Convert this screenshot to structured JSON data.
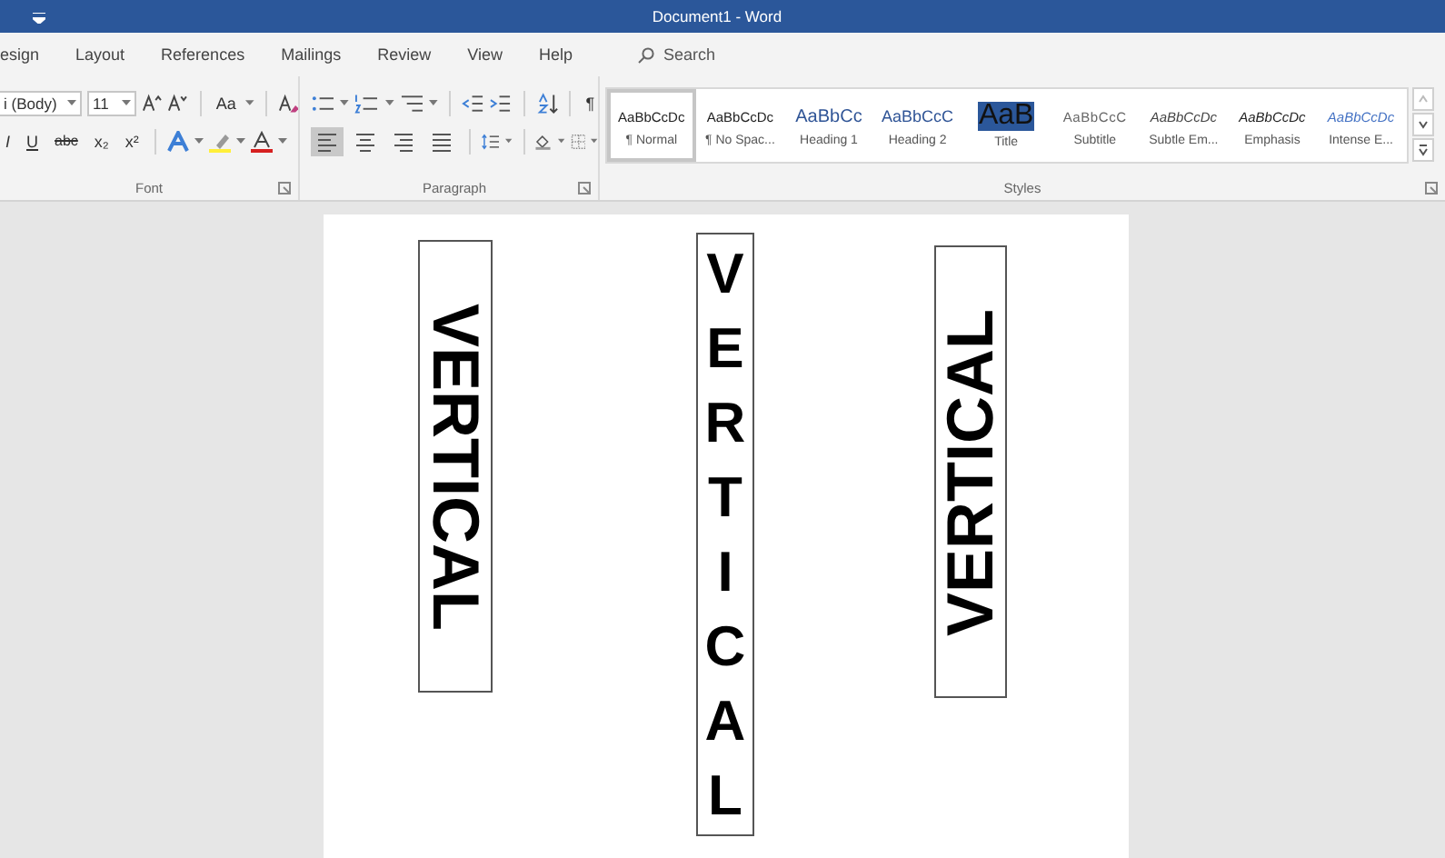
{
  "window": {
    "title": "Document1 - Word"
  },
  "tabs": [
    {
      "label": "esign",
      "selected": false
    },
    {
      "label": "Layout",
      "selected": false
    },
    {
      "label": "References",
      "selected": false
    },
    {
      "label": "Mailings",
      "selected": false
    },
    {
      "label": "Review",
      "selected": false
    },
    {
      "label": "View",
      "selected": false
    },
    {
      "label": "Help",
      "selected": false
    }
  ],
  "search": {
    "placeholder": "Search"
  },
  "font_group": {
    "label": "Font",
    "font_name": "i (Body)",
    "font_size": "11",
    "case_button": "Aa",
    "format_buttons": [
      "I",
      "U",
      "abc",
      "x₂",
      "x²"
    ]
  },
  "paragraph_group": {
    "label": "Paragraph",
    "pilcrow": "¶",
    "alignment": [
      {
        "kind": "left",
        "selected": true
      },
      {
        "kind": "center",
        "selected": false
      },
      {
        "kind": "right",
        "selected": false
      },
      {
        "kind": "justify",
        "selected": false
      }
    ]
  },
  "styles_group": {
    "label": "Styles",
    "items": [
      {
        "kind": "normal",
        "preview": "AaBbCcDc",
        "name": "¶ Normal",
        "selected": true
      },
      {
        "kind": "no-spacing",
        "preview": "AaBbCcDc",
        "name": "¶ No Spac...",
        "selected": false
      },
      {
        "kind": "heading1",
        "preview": "AaBbCc",
        "name": "Heading 1",
        "selected": false
      },
      {
        "kind": "heading2",
        "preview": "AaBbCcC",
        "name": "Heading 2",
        "selected": false
      },
      {
        "kind": "title",
        "preview": "AaB",
        "name": "Title",
        "selected": false
      },
      {
        "kind": "subtitle",
        "preview": "AaBbCcC",
        "name": "Subtitle",
        "selected": false
      },
      {
        "kind": "subtle-emphasis",
        "preview": "AaBbCcDc",
        "name": "Subtle Em...",
        "selected": false
      },
      {
        "kind": "emphasis",
        "preview": "AaBbCcDc",
        "name": "Emphasis",
        "selected": false
      },
      {
        "kind": "intense-emphasis",
        "preview": "AaBbCcDc",
        "name": "Intense E...",
        "selected": false
      }
    ]
  },
  "document": {
    "text_boxes": [
      {
        "kind": "rotated-down",
        "text": "VERTICAL"
      },
      {
        "kind": "stacked",
        "text": "VERTICAL"
      },
      {
        "kind": "rotated-up",
        "text": "VERTICAL"
      }
    ]
  }
}
